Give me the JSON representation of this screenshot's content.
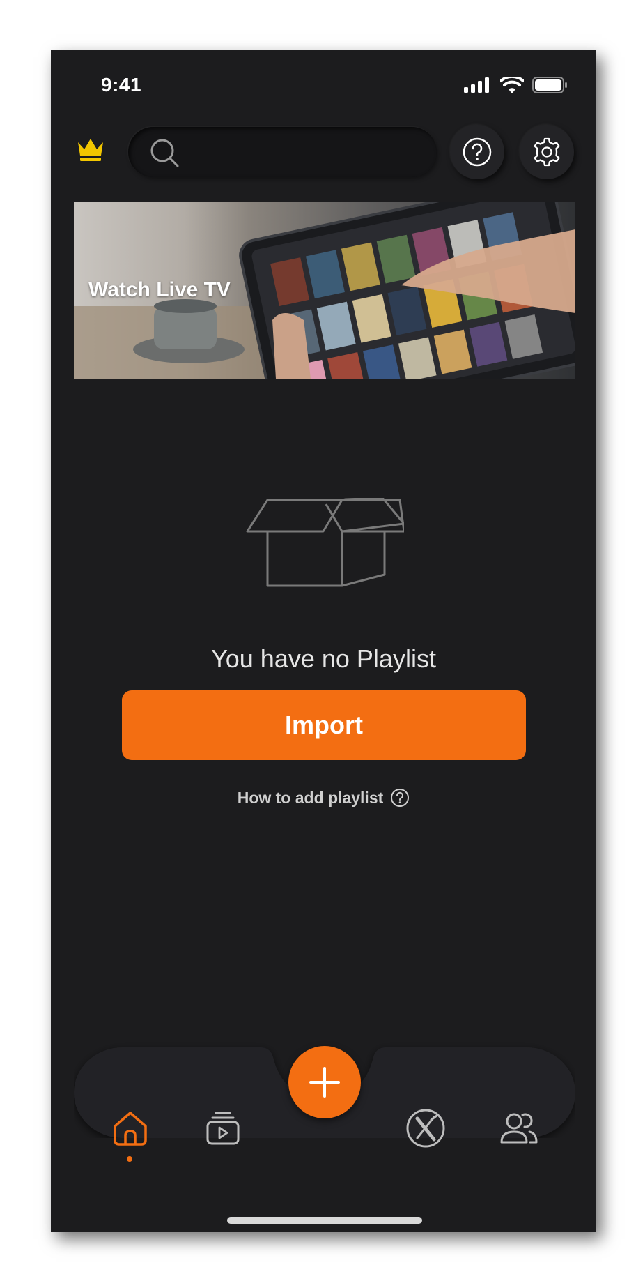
{
  "status_bar": {
    "time": "9:41"
  },
  "header": {
    "search": {
      "placeholder": ""
    },
    "icons": [
      "crown-icon",
      "search-icon",
      "help-icon",
      "gear-icon"
    ]
  },
  "banner": {
    "title": "Watch Live TV"
  },
  "empty_state": {
    "message": "You have no Playlist",
    "import_label": "Import",
    "help_link": "How to add playlist"
  },
  "tab_bar": {
    "items": [
      "home-icon",
      "media-library-icon",
      "add-icon",
      "x-circle-icon",
      "users-icon"
    ],
    "active": "home-icon"
  },
  "colors": {
    "accent": "#f36e12",
    "crown": "#f2c600",
    "background": "#1c1c1e"
  }
}
